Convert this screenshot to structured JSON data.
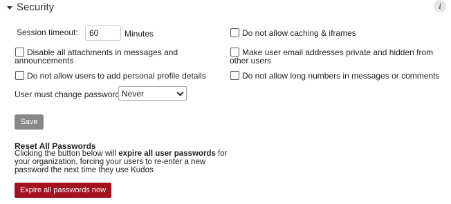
{
  "section": {
    "title": "Security",
    "info_icon": "i"
  },
  "session": {
    "label": "Session timeout:",
    "value": "60",
    "unit": "Minutes"
  },
  "options": {
    "disable_attachments": {
      "line1": "Disable all attachments in messages and",
      "line2": "announcements",
      "checked": false
    },
    "no_profile_details": {
      "label": "Do not allow users to add personal profile details",
      "checked": false
    },
    "no_caching": {
      "label": "Do not allow caching & iframes",
      "checked": false
    },
    "private_email": {
      "line1": "Make user email addresses private and hidden from",
      "line2": "other users",
      "checked": false
    },
    "no_long_numbers": {
      "label": "Do not allow long numbers in messages or comments",
      "checked": false
    }
  },
  "password_change": {
    "label": "User must change password",
    "selected": "Never"
  },
  "save_label": "Save",
  "reset": {
    "title": "Reset All Passwords",
    "desc_prefix": "Clicking the button below will ",
    "desc_bold": "expire all user passwords",
    "desc_suffix": " for your organization, forcing your users to re-enter a new password the next time they use Kudos",
    "button_label": "Expire all passwords now"
  },
  "colors": {
    "save_button": "#888888",
    "expire_button": "#a3101e"
  }
}
